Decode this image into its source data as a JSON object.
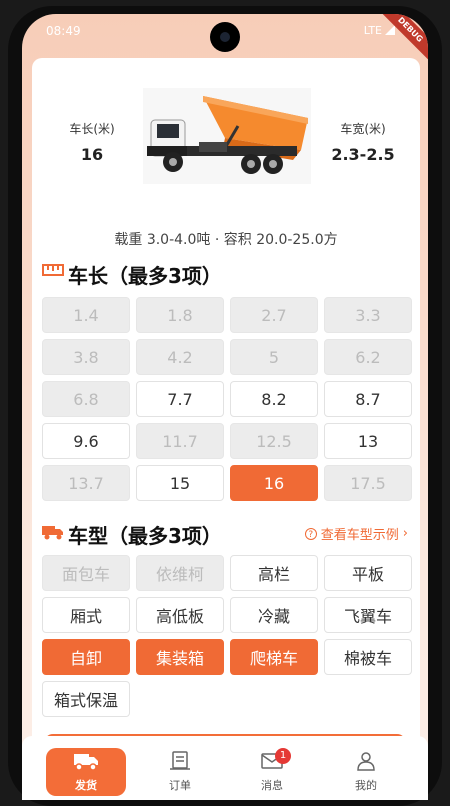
{
  "status_bar": {
    "time": "08:49",
    "network": "LTE",
    "debug_banner": "DEBUG"
  },
  "vehicle_info": {
    "length_label": "车长(米)",
    "length_value": "16",
    "width_label": "车宽(米)",
    "width_value": "2.3-2.5",
    "capacity_text": "载重 3.0-4.0吨 · 容积 20.0-25.0方"
  },
  "length_section": {
    "title": "车长（最多3项）",
    "options": [
      {
        "label": "1.4",
        "state": "disabled"
      },
      {
        "label": "1.8",
        "state": "disabled"
      },
      {
        "label": "2.7",
        "state": "disabled"
      },
      {
        "label": "3.3",
        "state": "disabled"
      },
      {
        "label": "3.8",
        "state": "disabled"
      },
      {
        "label": "4.2",
        "state": "disabled"
      },
      {
        "label": "5",
        "state": "disabled"
      },
      {
        "label": "6.2",
        "state": "disabled"
      },
      {
        "label": "6.8",
        "state": "disabled"
      },
      {
        "label": "7.7",
        "state": "normal"
      },
      {
        "label": "8.2",
        "state": "normal"
      },
      {
        "label": "8.7",
        "state": "normal"
      },
      {
        "label": "9.6",
        "state": "normal"
      },
      {
        "label": "11.7",
        "state": "disabled"
      },
      {
        "label": "12.5",
        "state": "disabled"
      },
      {
        "label": "13",
        "state": "normal"
      },
      {
        "label": "13.7",
        "state": "disabled"
      },
      {
        "label": "15",
        "state": "normal"
      },
      {
        "label": "16",
        "state": "selected"
      },
      {
        "label": "17.5",
        "state": "disabled"
      }
    ]
  },
  "type_section": {
    "title": "车型（最多3项）",
    "example_link": "查看车型示例",
    "options": [
      {
        "label": "面包车",
        "state": "disabled"
      },
      {
        "label": "依维柯",
        "state": "disabled"
      },
      {
        "label": "高栏",
        "state": "normal"
      },
      {
        "label": "平板",
        "state": "normal"
      },
      {
        "label": "厢式",
        "state": "normal"
      },
      {
        "label": "高低板",
        "state": "normal"
      },
      {
        "label": "冷藏",
        "state": "normal"
      },
      {
        "label": "飞翼车",
        "state": "normal"
      },
      {
        "label": "自卸",
        "state": "selected"
      },
      {
        "label": "集装箱",
        "state": "selected"
      },
      {
        "label": "爬梯车",
        "state": "selected"
      },
      {
        "label": "棉被车",
        "state": "normal"
      },
      {
        "label": "箱式保温",
        "state": "normal"
      }
    ]
  },
  "bottom_nav": {
    "items": [
      {
        "label": "发货",
        "icon": "truck-icon",
        "active": true
      },
      {
        "label": "订单",
        "icon": "order-icon",
        "active": false
      },
      {
        "label": "消息",
        "icon": "mail-icon",
        "active": false,
        "badge": "1"
      },
      {
        "label": "我的",
        "icon": "user-icon",
        "active": false
      }
    ]
  },
  "colors": {
    "accent": "#f06a35",
    "disabled_bg": "#ececec",
    "disabled_text": "#bcbcbc"
  }
}
